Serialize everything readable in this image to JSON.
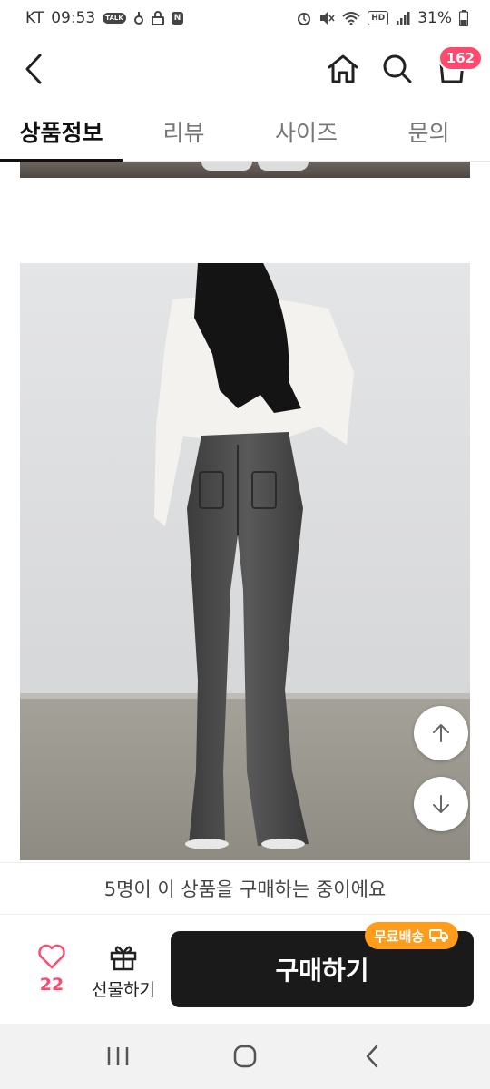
{
  "status_bar": {
    "carrier": "KT",
    "time": "09:53",
    "talk_badge": "TALK",
    "n_badge": "N",
    "hd_badge": "HD",
    "battery": "31%"
  },
  "header": {
    "icons": [
      "back-arrow-icon",
      "home-icon",
      "search-icon",
      "shopping-bag-icon"
    ],
    "cart_count": "162"
  },
  "tabs": [
    {
      "label": "상품정보",
      "active": true
    },
    {
      "label": "리뷰",
      "active": false
    },
    {
      "label": "사이즈",
      "active": false
    },
    {
      "label": "문의",
      "active": false
    }
  ],
  "notice": "5명이 이 상품을 구매하는 중이에요",
  "actions": {
    "like_count": "22",
    "gift_label": "선물하기",
    "buy_label": "구매하기",
    "shipping_badge": "무료배송"
  },
  "colors": {
    "accent": "#ff4a6e",
    "buy_button": "#1a1a1a",
    "shipping_badge": "#ff9d1b"
  }
}
